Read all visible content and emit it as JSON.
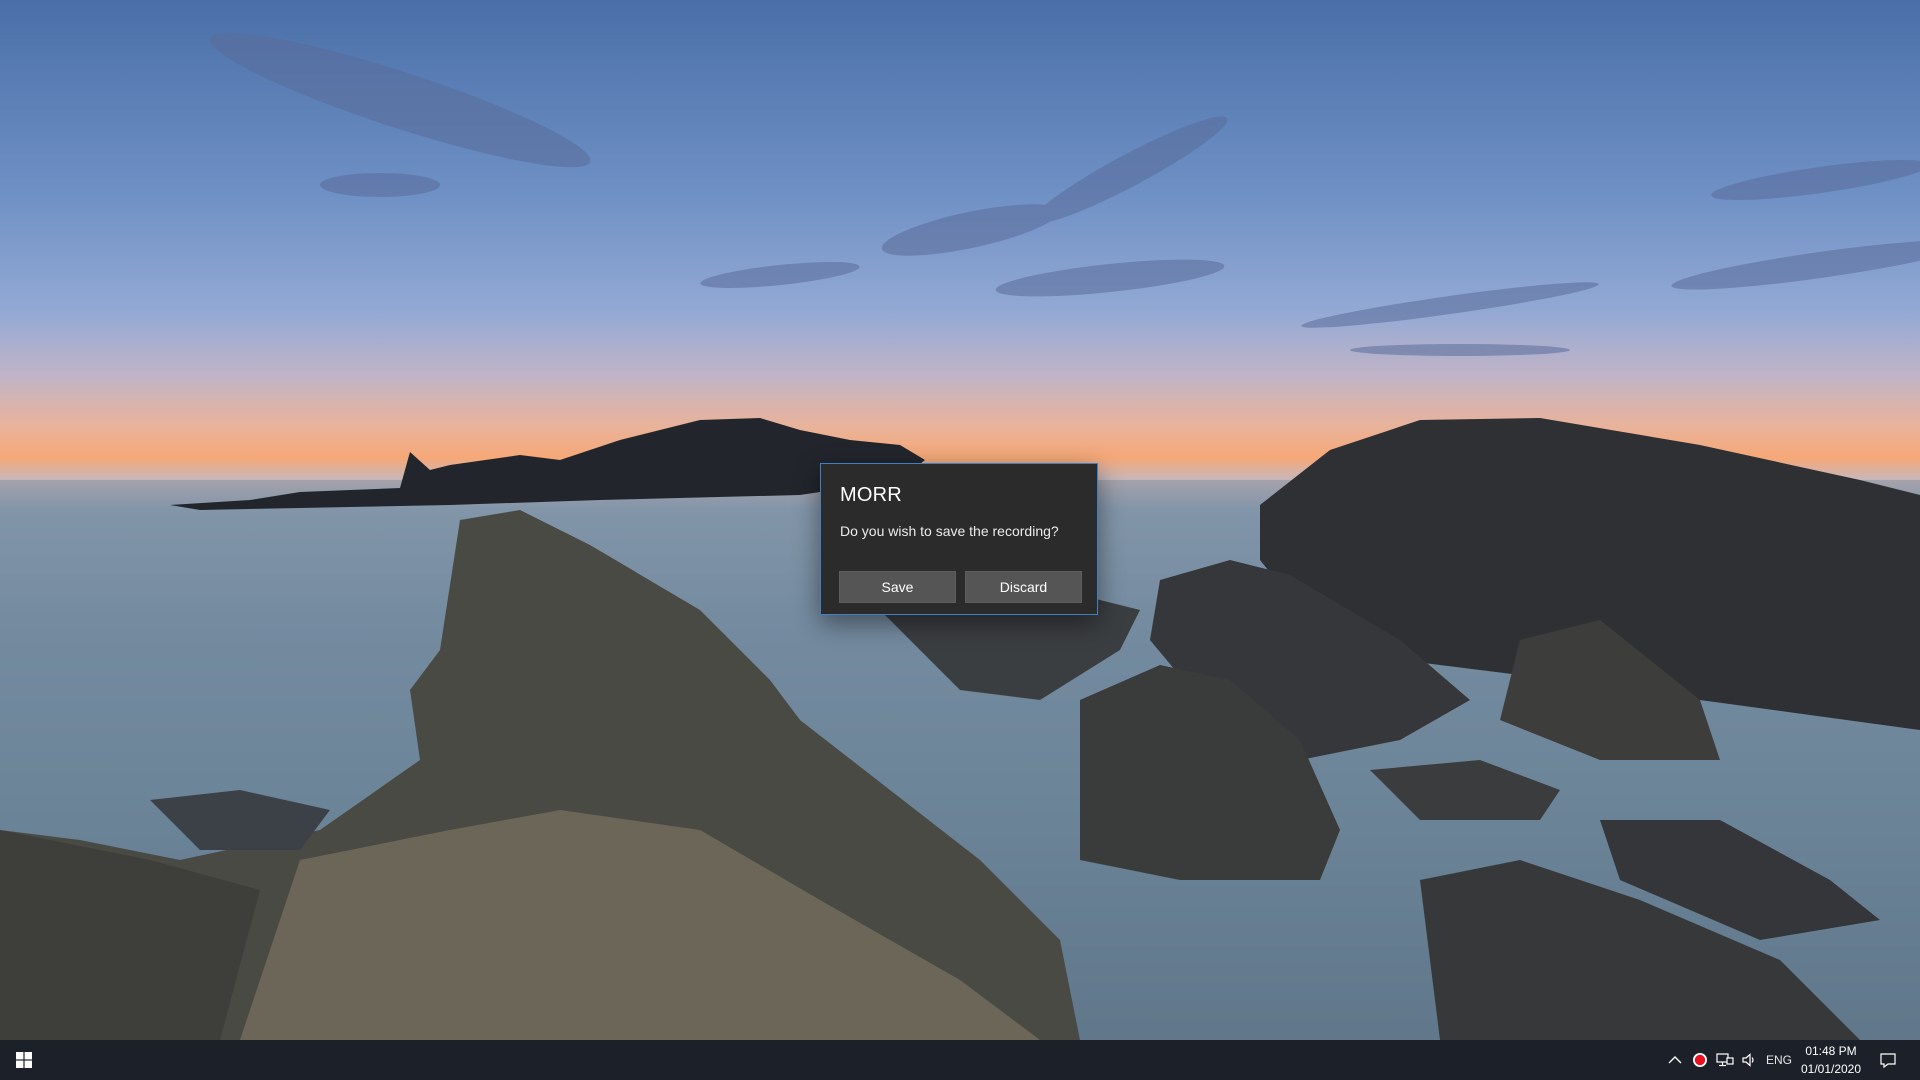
{
  "dialog": {
    "title": "MORR",
    "message": "Do you wish to save the recording?",
    "save_label": "Save",
    "discard_label": "Discard"
  },
  "taskbar": {
    "start_icon": "windows-logo-icon",
    "tray": {
      "overflow_icon": "chevron-up-icon",
      "recording_icon": "record-icon",
      "network_icon": "network-icon",
      "volume_icon": "speaker-icon",
      "language": "ENG",
      "time": "01:48 PM",
      "date": "01/01/2020",
      "notifications_icon": "action-center-icon"
    }
  },
  "colors": {
    "dialog_background": "#2b2b2b",
    "dialog_border": "#3e7fc6",
    "button_background": "#555555",
    "taskbar_background": "#1c2129",
    "record_red": "#e81123"
  }
}
